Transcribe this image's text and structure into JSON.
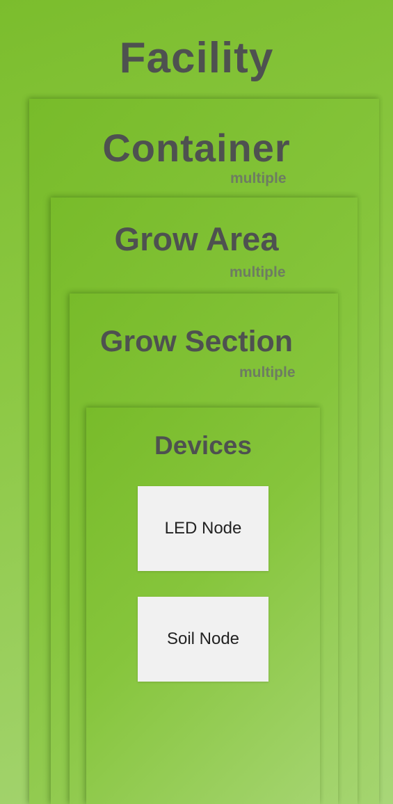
{
  "diagram": {
    "layers": [
      {
        "title": "Facility",
        "subtitle": ""
      },
      {
        "title": "Container",
        "subtitle": "multiple"
      },
      {
        "title": "Grow Area",
        "subtitle": "multiple"
      },
      {
        "title": "Grow Section",
        "subtitle": "multiple"
      },
      {
        "title": "Devices",
        "subtitle": ""
      }
    ],
    "devices": [
      {
        "label": "LED Node"
      },
      {
        "label": "Soil Node"
      }
    ],
    "colors": {
      "layer_green": "#86c53c",
      "title_text": "#4e5150",
      "subtitle_text": "#6d7c62",
      "node_box": "#f1f1f1"
    }
  }
}
